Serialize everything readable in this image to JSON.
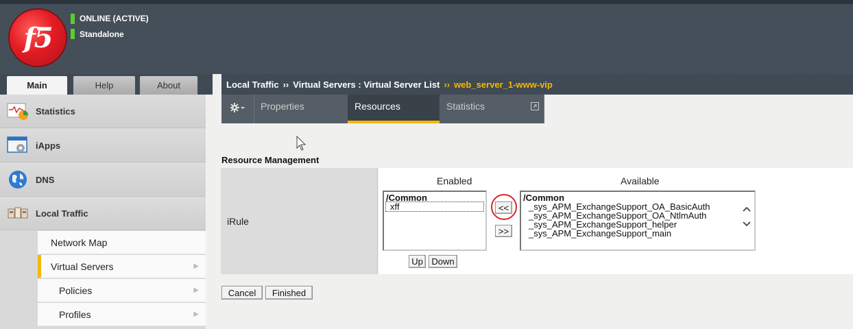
{
  "header": {
    "status_lines": [
      "ONLINE (ACTIVE)",
      "Standalone"
    ],
    "logo_text": "f5",
    "status_color": "#5bcf2c"
  },
  "nav_tabs": [
    "Main",
    "Help",
    "About"
  ],
  "sidebar": {
    "items": [
      {
        "label": "Statistics",
        "icon": "statistics-chart-icon"
      },
      {
        "label": "iApps",
        "icon": "iapps-window-icon"
      },
      {
        "label": "DNS",
        "icon": "dns-globe-icon"
      },
      {
        "label": "Local Traffic",
        "icon": "local-traffic-icon"
      }
    ],
    "subitems": [
      {
        "label": "Network Map"
      },
      {
        "label": "Virtual Servers"
      },
      {
        "label": "Policies"
      },
      {
        "label": "Profiles"
      }
    ]
  },
  "breadcrumb": {
    "part1": "Local Traffic",
    "sep": "››",
    "part2": "Virtual Servers : Virtual Server List",
    "current": "web_server_1-www-vip"
  },
  "tabs": {
    "gear_icon": "gear-icon",
    "items": [
      "Properties",
      "Resources",
      "Statistics"
    ],
    "active": "Resources",
    "popout_icon": "popout-icon"
  },
  "section": {
    "title": "Resource Management",
    "row_label": "iRule",
    "enabled_header": "Enabled",
    "available_header": "Available"
  },
  "enabled_list": {
    "group": "/Common",
    "options": [
      "xff"
    ]
  },
  "available_list": {
    "group": "/Common",
    "options": [
      "_sys_APM_ExchangeSupport_OA_BasicAuth",
      "_sys_APM_ExchangeSupport_OA_NtlmAuth",
      "_sys_APM_ExchangeSupport_helper",
      "_sys_APM_ExchangeSupport_main"
    ]
  },
  "buttons": {
    "move_left": "<<",
    "move_right": ">>",
    "up": "Up",
    "down": "Down",
    "cancel": "Cancel",
    "finished": "Finished"
  },
  "colors": {
    "accent": "#f5b800",
    "header_bg": "#3f4a55",
    "highlight_circle": "#d42727"
  }
}
